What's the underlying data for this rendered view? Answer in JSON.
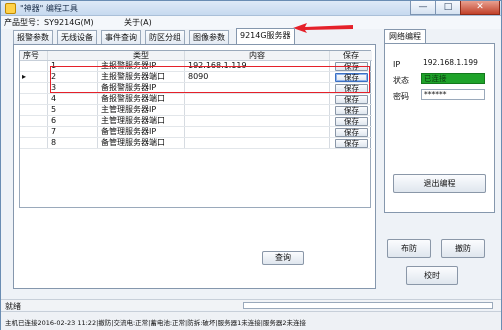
{
  "window": {
    "title": "\"神器\" 编程工具",
    "minimize": "—",
    "maximize": "□",
    "close": "✕"
  },
  "menu": {
    "product_label": "产品型号：SY9214G(M)",
    "about": "关于(A)"
  },
  "tabs": [
    "报警参数",
    "无线设备",
    "事件查询",
    "防区分组",
    "图像参数",
    "9214G服务器"
  ],
  "active_tab_index": 5,
  "table": {
    "columns": [
      "序号",
      "类型",
      "内容",
      "保存"
    ],
    "rows": [
      {
        "no": "1",
        "type": "主报警服务器IP",
        "content": "192.168.1.119",
        "save": "保存"
      },
      {
        "no": "2",
        "type": "主报警服务器端口",
        "content": "8090",
        "save": "保存",
        "current": true
      },
      {
        "no": "3",
        "type": "备报警服务器IP",
        "content": "",
        "save": "保存"
      },
      {
        "no": "4",
        "type": "备报警服务器端口",
        "content": "",
        "save": "保存"
      },
      {
        "no": "5",
        "type": "主管理服务器IP",
        "content": "",
        "save": "保存"
      },
      {
        "no": "6",
        "type": "主管理服务器端口",
        "content": "",
        "save": "保存"
      },
      {
        "no": "7",
        "type": "备管理服务器IP",
        "content": "",
        "save": "保存"
      },
      {
        "no": "8",
        "type": "备管理服务器端口",
        "content": "",
        "save": "保存"
      }
    ],
    "row_marker": "▸"
  },
  "query_button": "查询",
  "network": {
    "tab_label": "网络编程",
    "ip_label": "IP",
    "ip_value": "192.168.1.199",
    "status_label": "状态",
    "status_value": "已连接",
    "password_label": "密码",
    "password_value": "******",
    "exit_button": "退出编程",
    "status_color": "#1fa32a"
  },
  "actions": {
    "arm": "布防",
    "disarm": "撤防",
    "sync_time": "校时"
  },
  "statusbar": {
    "ready": "就绪",
    "info": "主机已连接2016-02-23 11:22|撤防|交流电:正常|蓄电池:正常|防拆:破坏|服务器1未连接|服务器2未连接"
  },
  "annotation_color": "#e5212a"
}
